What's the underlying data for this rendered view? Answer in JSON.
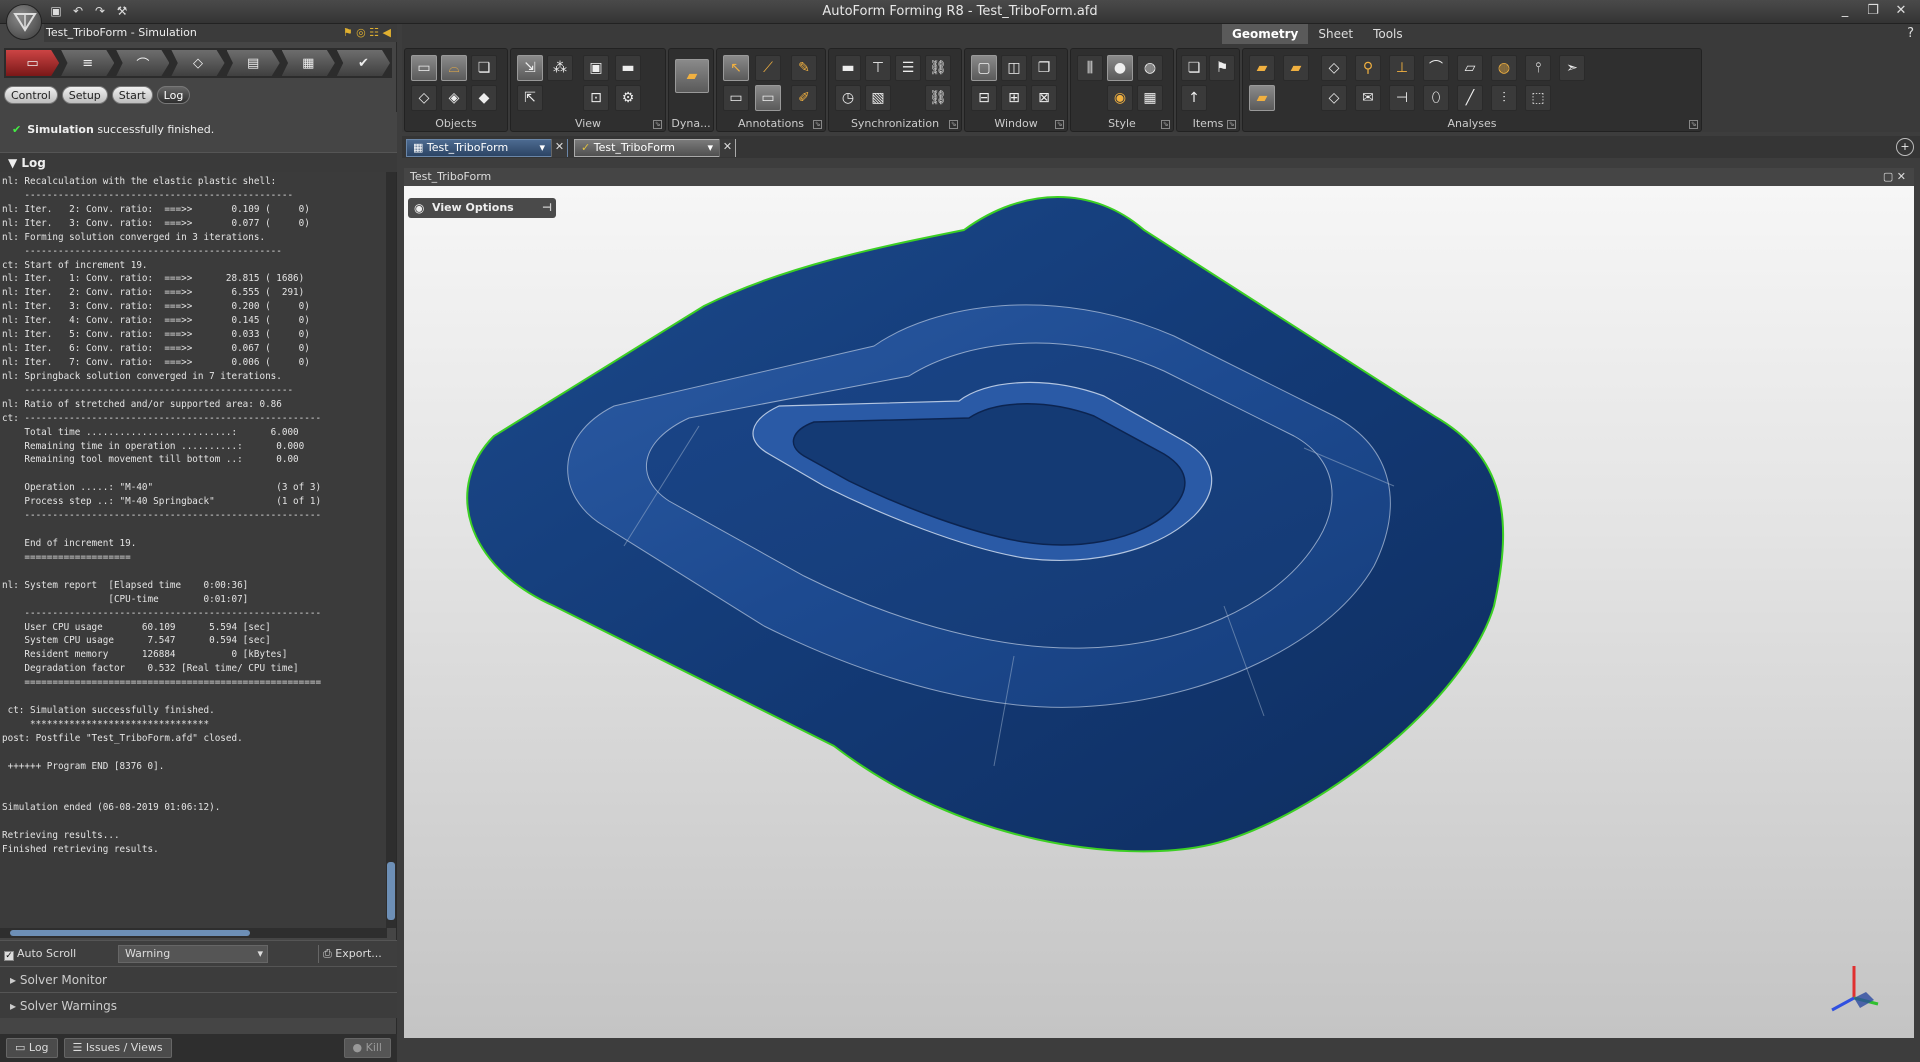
{
  "window": {
    "title": "AutoForm Forming R8 - Test_TriboForm.afd",
    "controls": [
      "_",
      "❐",
      "✕"
    ]
  },
  "left_panel": {
    "header": "Test_TriboForm - Simulation",
    "tabs": [
      "Control",
      "Setup",
      "Start",
      "Log"
    ],
    "active_tab": "Log",
    "status_bold": "Simulation",
    "status_text": "successfully finished.",
    "log_title": "Log",
    "log_text": "nl: Recalculation with the elastic plastic shell:\n    ------------------------------------------------\nnl: Iter.   2: Conv. ratio:  ===>>       0.109 (     0)\nnl: Iter.   3: Conv. ratio:  ===>>       0.077 (     0)\nnl: Forming solution converged in 3 iterations.\n    ----------------------------------------------\nct: Start of increment 19.\nnl: Iter.   1: Conv. ratio:  ===>>      28.815 ( 1686)\nnl: Iter.   2: Conv. ratio:  ===>>       6.555 (  291)\nnl: Iter.   3: Conv. ratio:  ===>>       0.200 (     0)\nnl: Iter.   4: Conv. ratio:  ===>>       0.145 (     0)\nnl: Iter.   5: Conv. ratio:  ===>>       0.033 (     0)\nnl: Iter.   6: Conv. ratio:  ===>>       0.067 (     0)\nnl: Iter.   7: Conv. ratio:  ===>>       0.006 (     0)\nnl: Springback solution converged in 7 iterations.\n    ------------------------------------------------\nnl: Ratio of stretched and/or supported area: 0.86\nct: -----------------------------------------------------\n    Total time ..........................:      6.000\n    Remaining time in operation ..........:      0.000\n    Remaining tool movement till bottom ..:      0.00\n\n    Operation .....: \"M-40\"                      (3 of 3)\n    Process step ..: \"M-40 Springback\"           (1 of 1)\n    -----------------------------------------------------\n\n    End of increment 19.\n    ===================\n\nnl: System report  [Elapsed time    0:00:36]\n                   [CPU-time        0:01:07]\n    -----------------------------------------------------\n    User CPU usage       60.109      5.594 [sec]\n    System CPU usage      7.547      0.594 [sec]\n    Resident memory      126884          0 [kBytes]\n    Degradation factor    0.532 [Real time/ CPU time]\n    =====================================================\n\n ct: Simulation successfully finished.\n     ********************************\npost: Postfile \"Test_TriboForm.afd\" closed.\n\n ++++++ Program END [8376 0].\n\n\nSimulation ended (06-08-2019 01:06:12).\n\nRetrieving results...\nFinished retrieving results.",
    "auto_scroll_label": "Auto Scroll",
    "auto_scroll_checked": true,
    "filter_value": "Warning",
    "export_label": "Export...",
    "sections": [
      "Solver Monitor",
      "Solver Warnings"
    ],
    "bottom_tabs": [
      "Log",
      "Issues / Views",
      "Kill"
    ]
  },
  "ribbon": {
    "tabs": [
      "Geometry",
      "Sheet",
      "Tools"
    ],
    "active_tab": "Geometry",
    "groups": [
      "Objects",
      "View",
      "Dyna...",
      "Annotations",
      "Synchronization",
      "Window",
      "Style",
      "Items",
      "Analyses"
    ]
  },
  "documents": {
    "tabs": [
      "Test_TriboForm",
      "Test_TriboForm"
    ],
    "add_label": "+"
  },
  "viewport": {
    "title": "Test_TriboForm",
    "view_options_label": "View Options",
    "part_color": "#163d7a",
    "edge_color": "#38c81e"
  }
}
